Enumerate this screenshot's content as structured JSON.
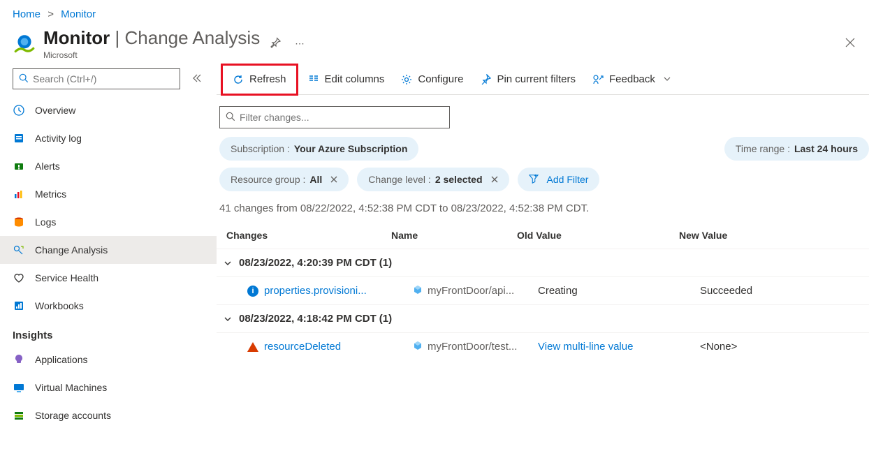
{
  "breadcrumb": {
    "home": "Home",
    "monitor": "Monitor"
  },
  "header": {
    "title_main": "Monitor",
    "title_sep": " | ",
    "title_sub": "Change Analysis",
    "publisher": "Microsoft"
  },
  "sidebar": {
    "search_placeholder": "Search (Ctrl+/)",
    "items": [
      {
        "label": "Overview"
      },
      {
        "label": "Activity log"
      },
      {
        "label": "Alerts"
      },
      {
        "label": "Metrics"
      },
      {
        "label": "Logs"
      },
      {
        "label": "Change Analysis"
      },
      {
        "label": "Service Health"
      },
      {
        "label": "Workbooks"
      }
    ],
    "insights_header": "Insights",
    "insights": [
      {
        "label": "Applications"
      },
      {
        "label": "Virtual Machines"
      },
      {
        "label": "Storage accounts"
      }
    ]
  },
  "toolbar": {
    "refresh": "Refresh",
    "edit_columns": "Edit columns",
    "configure": "Configure",
    "pin": "Pin current filters",
    "feedback": "Feedback"
  },
  "filters": {
    "filter_placeholder": "Filter changes...",
    "subscription_label": "Subscription : ",
    "subscription_value": "Your Azure Subscription",
    "timerange_label": "Time range : ",
    "timerange_value": "Last 24 hours",
    "resgroup_label": "Resource group : ",
    "resgroup_value": "All",
    "changelevel_label": "Change level : ",
    "changelevel_value": "2 selected",
    "add_filter": "Add Filter"
  },
  "summary": "41 changes from 08/22/2022, 4:52:38 PM CDT to 08/23/2022, 4:52:38 PM CDT.",
  "table": {
    "headers": {
      "changes": "Changes",
      "name": "Name",
      "old": "Old Value",
      "new": "New Value"
    },
    "groups": [
      {
        "timestamp": "08/23/2022, 4:20:39 PM CDT",
        "count": "(1)",
        "rows": [
          {
            "status": "info",
            "change": "properties.provisioni...",
            "name": "myFrontDoor/api...",
            "old": "Creating",
            "new": "Succeeded"
          }
        ]
      },
      {
        "timestamp": "08/23/2022, 4:18:42 PM CDT",
        "count": "(1)",
        "rows": [
          {
            "status": "warn",
            "change": "resourceDeleted",
            "name": "myFrontDoor/test...",
            "old_link": "View multi-line value",
            "new": "<None>"
          }
        ]
      }
    ]
  }
}
